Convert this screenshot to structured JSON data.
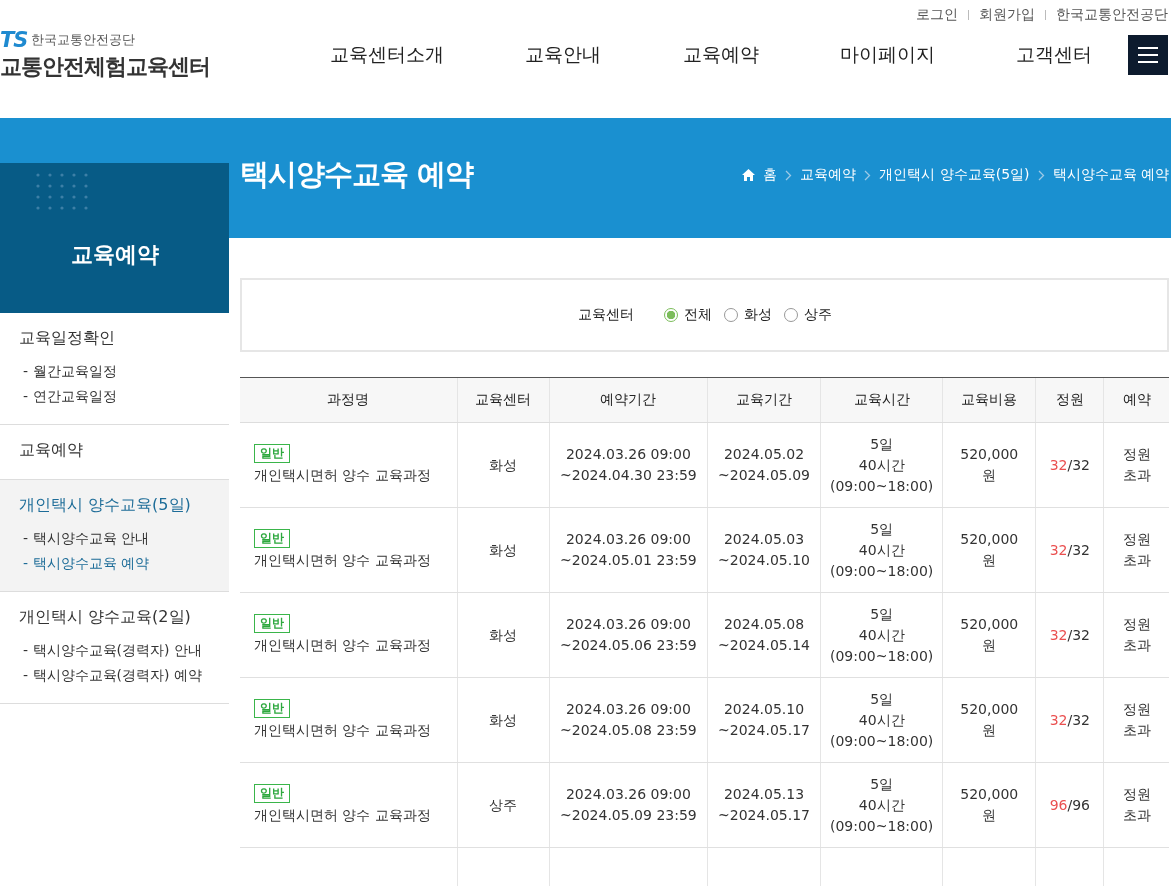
{
  "top_links": [
    "로그인",
    "회원가입",
    "한국교통안전공단"
  ],
  "logo": {
    "mark": "TS",
    "org": "한국교통안전공단",
    "title": "교통안전체험교육센터"
  },
  "nav": [
    "교육센터소개",
    "교육안내",
    "교육예약",
    "마이페이지",
    "고객센터"
  ],
  "sidebar": {
    "title": "교육예약",
    "groups": [
      {
        "title": "교육일정확인",
        "selected": false,
        "children": [
          {
            "label": "- 월간교육일정",
            "selected": false
          },
          {
            "label": "- 연간교육일정",
            "selected": false
          }
        ]
      },
      {
        "title": "교육예약",
        "selected": false
      },
      {
        "title": "개인택시 양수교육(5일)",
        "selected": true,
        "children": [
          {
            "label": "- 택시양수교육 안내",
            "selected": false
          },
          {
            "label": "- 택시양수교육 예약",
            "selected": true
          }
        ]
      },
      {
        "title": "개인택시 양수교육(2일)",
        "selected": false,
        "children": [
          {
            "label": "- 택시양수교육(경력자) 안내",
            "selected": false
          },
          {
            "label": "- 택시양수교육(경력자) 예약",
            "selected": false
          }
        ]
      }
    ]
  },
  "page_title": "택시양수교육 예약",
  "breadcrumb": [
    "홈",
    "교육예약",
    "개인택시 양수교육(5일)",
    "택시양수교육 예약"
  ],
  "filter": {
    "label": "교육센터",
    "options": [
      {
        "label": "전체",
        "selected": true
      },
      {
        "label": "화성",
        "selected": false
      },
      {
        "label": "상주",
        "selected": false
      }
    ]
  },
  "table": {
    "columns": [
      "과정명",
      "교육센터",
      "예약기간",
      "교육기간",
      "교육시간",
      "교육비용",
      "정원",
      "예약"
    ],
    "rows": [
      {
        "badge": "일반",
        "course": "개인택시면허 양수 교육과정",
        "center": "화성",
        "reserve": [
          "2024.03.26 09:00",
          "~2024.04.30 23:59"
        ],
        "period": [
          "2024.05.02",
          "~2024.05.09"
        ],
        "time": [
          "5일",
          "40시간",
          "(09:00~18:00)"
        ],
        "fee": [
          "520,000",
          "원"
        ],
        "applied": "32",
        "limit": "/32",
        "status": [
          "정원",
          "초과"
        ]
      },
      {
        "badge": "일반",
        "course": "개인택시면허 양수 교육과정",
        "center": "화성",
        "reserve": [
          "2024.03.26 09:00",
          "~2024.05.01 23:59"
        ],
        "period": [
          "2024.05.03",
          "~2024.05.10"
        ],
        "time": [
          "5일",
          "40시간",
          "(09:00~18:00)"
        ],
        "fee": [
          "520,000",
          "원"
        ],
        "applied": "32",
        "limit": "/32",
        "status": [
          "정원",
          "초과"
        ]
      },
      {
        "badge": "일반",
        "course": "개인택시면허 양수 교육과정",
        "center": "화성",
        "reserve": [
          "2024.03.26 09:00",
          "~2024.05.06 23:59"
        ],
        "period": [
          "2024.05.08",
          "~2024.05.14"
        ],
        "time": [
          "5일",
          "40시간",
          "(09:00~18:00)"
        ],
        "fee": [
          "520,000",
          "원"
        ],
        "applied": "32",
        "limit": "/32",
        "status": [
          "정원",
          "초과"
        ]
      },
      {
        "badge": "일반",
        "course": "개인택시면허 양수 교육과정",
        "center": "화성",
        "reserve": [
          "2024.03.26 09:00",
          "~2024.05.08 23:59"
        ],
        "period": [
          "2024.05.10",
          "~2024.05.17"
        ],
        "time": [
          "5일",
          "40시간",
          "(09:00~18:00)"
        ],
        "fee": [
          "520,000",
          "원"
        ],
        "applied": "32",
        "limit": "/32",
        "status": [
          "정원",
          "초과"
        ]
      },
      {
        "badge": "일반",
        "course": "개인택시면허 양수 교육과정",
        "center": "상주",
        "reserve": [
          "2024.03.26 09:00",
          "~2024.05.09 23:59"
        ],
        "period": [
          "2024.05.13",
          "~2024.05.17"
        ],
        "time": [
          "5일",
          "40시간",
          "(09:00~18:00)"
        ],
        "fee": [
          "520,000",
          "원"
        ],
        "applied": "96",
        "limit": "/96",
        "status": [
          "정원",
          "초과"
        ]
      }
    ]
  }
}
